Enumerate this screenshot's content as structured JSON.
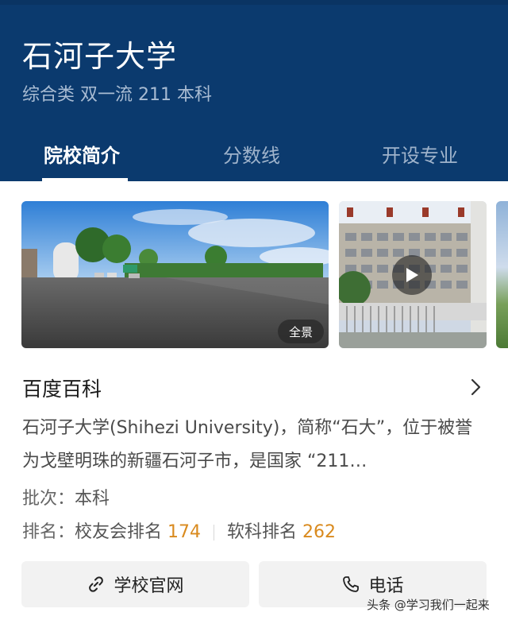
{
  "header": {
    "title": "石河子大学",
    "subtitle": "综合类 双一流 211 本科",
    "colors": {
      "background": "#0b3a6e",
      "active_tab": "#ffffff",
      "inactive_tab": "#9fb3cb"
    }
  },
  "tabs": [
    {
      "label": "院校简介",
      "active": true
    },
    {
      "label": "分数线",
      "active": false
    },
    {
      "label": "开设专业",
      "active": false
    }
  ],
  "gallery": {
    "panorama_badge": "全景",
    "icons": [
      "play-icon"
    ]
  },
  "baike": {
    "title": "百度百科",
    "description": "石河子大学(Shihezi University)，简称“石大”，位于被誉为戈壁明珠的新疆石河子市，是国家 “211…",
    "batch_label": "批次：",
    "batch_value": "本科",
    "rank_label": "排名：",
    "rank1_label": "校友会排名",
    "rank1_value": "174",
    "rank2_label": "软科排名",
    "rank2_value": "262",
    "accent_color": "#d98a1e"
  },
  "actions": {
    "website_label": "学校官网",
    "phone_label": "电话",
    "icons": [
      "link-icon",
      "phone-icon"
    ]
  },
  "watermark": "头条 @学习我们一起来"
}
